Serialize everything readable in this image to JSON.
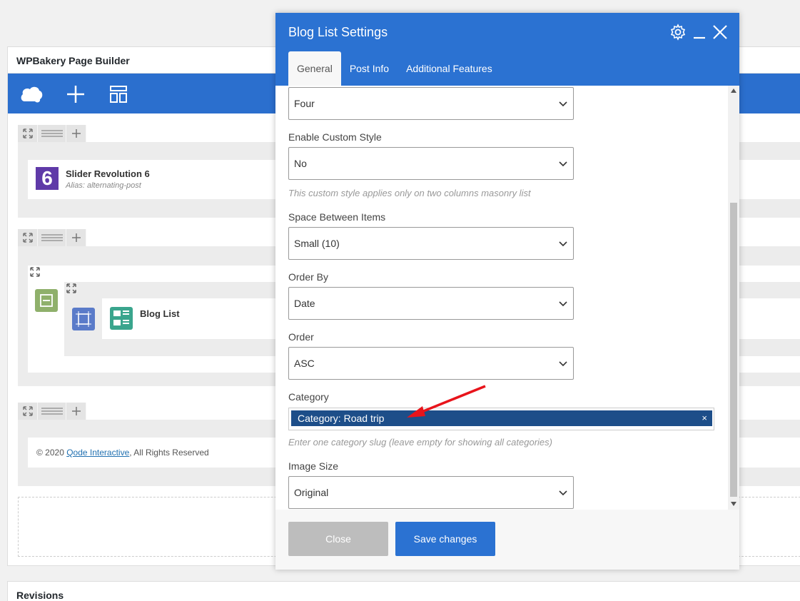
{
  "builder": {
    "title": "WPBakery Page Builder",
    "toolbar_icons": [
      "logo-icon",
      "plus-icon",
      "layout-icon"
    ],
    "elements": {
      "slider": {
        "title": "Slider Revolution 6",
        "alias": "Alias: alternating-post"
      },
      "blog_list": {
        "title": "Blog List"
      },
      "footer_text": {
        "prefix": "© 2020 ",
        "link": "Qode Interactive",
        "suffix": ", All Rights Reserved"
      }
    },
    "revisions": "Revisions"
  },
  "modal": {
    "title": "Blog List Settings",
    "tabs": [
      {
        "label": "General",
        "active": true
      },
      {
        "label": "Post Info"
      },
      {
        "label": "Additional Features"
      }
    ],
    "fields": {
      "columns": {
        "value": "Four"
      },
      "custom_style": {
        "label": "Enable Custom Style",
        "value": "No",
        "hint": "This custom style applies only on two columns masonry list"
      },
      "space": {
        "label": "Space Between Items",
        "value": "Small (10)"
      },
      "order_by": {
        "label": "Order By",
        "value": "Date"
      },
      "order": {
        "label": "Order",
        "value": "ASC"
      },
      "category": {
        "label": "Category",
        "chip": "Category: Road trip",
        "remove": "×",
        "hint": "Enter one category slug (leave empty for showing all categories)"
      },
      "image_size": {
        "label": "Image Size",
        "value": "Original"
      }
    },
    "buttons": {
      "close": "Close",
      "save": "Save changes"
    }
  },
  "colors": {
    "accent": "#2b72d2",
    "chip": "#1d4e89",
    "arrow": "#e8141b"
  }
}
